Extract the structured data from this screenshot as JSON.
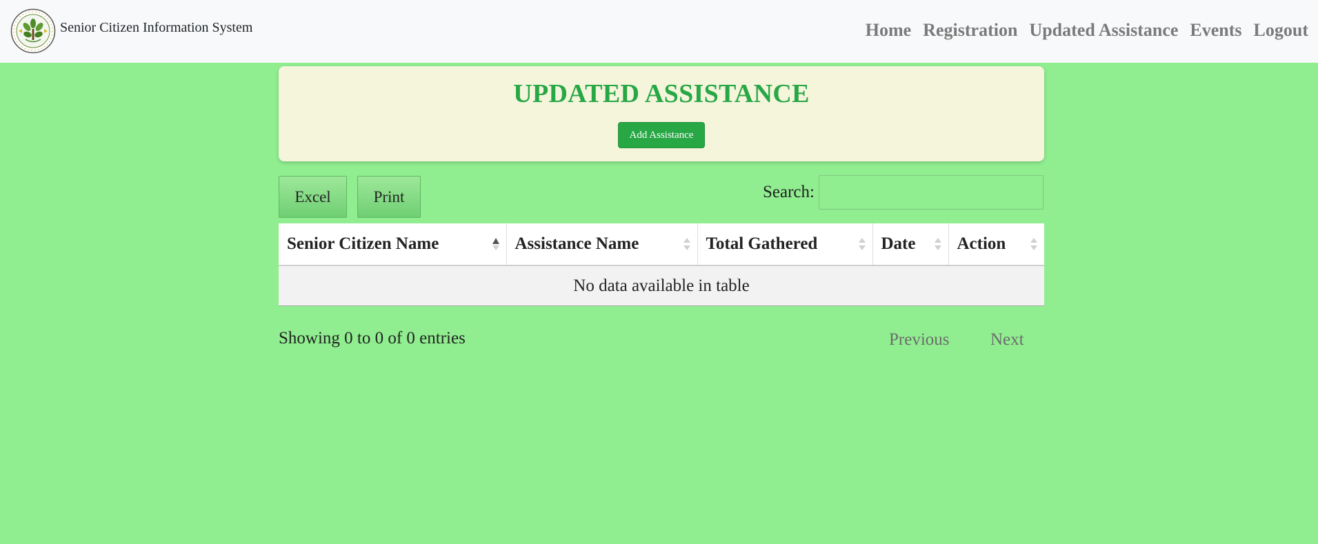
{
  "navbar": {
    "brand_title": "Senior Citizen Information System",
    "logo_icon": "barangay-seal-logo",
    "links": [
      {
        "label": "Home"
      },
      {
        "label": "Registration"
      },
      {
        "label": "Updated Assistance"
      },
      {
        "label": "Events"
      },
      {
        "label": "Logout"
      }
    ]
  },
  "header": {
    "title": "UPDATED ASSISTANCE",
    "add_button_label": "Add Assistance"
  },
  "toolbar": {
    "excel_label": "Excel",
    "print_label": "Print",
    "search_label": "Search:",
    "search_value": ""
  },
  "table": {
    "columns": [
      {
        "label": "Senior Citizen Name",
        "sort": "ascending"
      },
      {
        "label": "Assistance Name",
        "sort": "none"
      },
      {
        "label": "Total Gathered",
        "sort": "none"
      },
      {
        "label": "Date",
        "sort": "none"
      },
      {
        "label": "Action",
        "sort": "none"
      }
    ],
    "empty_message": "No data available in table"
  },
  "footer": {
    "info": "Showing 0 to 0 of 0 entries",
    "previous_label": "Previous",
    "next_label": "Next"
  },
  "colors": {
    "page_background": "#90ee90",
    "navbar_background": "#f8f9fa",
    "card_background": "#f5f5dc",
    "title_color": "#28a745",
    "button_color": "#28a745"
  }
}
